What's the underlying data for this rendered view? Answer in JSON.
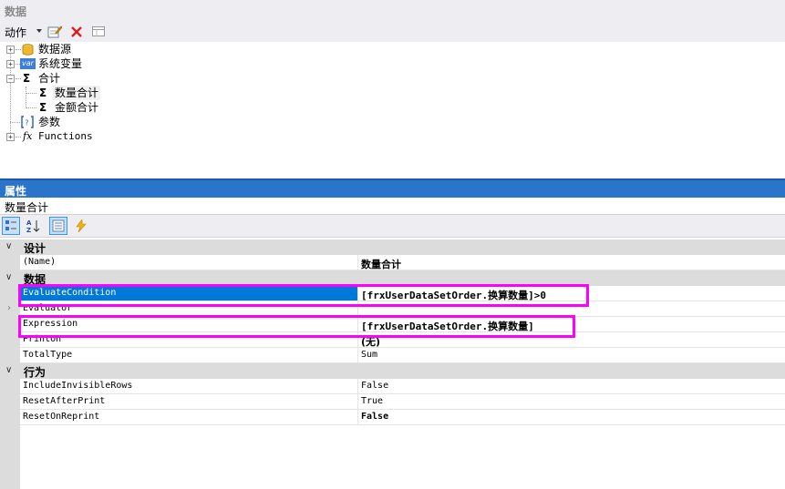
{
  "data_panel": {
    "title": "数据",
    "toolbar": {
      "actions_label": "动作"
    },
    "tree": {
      "datasource": "数据源",
      "system_vars": "系统变量",
      "system_vars_icon_text": "var",
      "totals": "合计",
      "total_qty": "数量合计",
      "total_amount": "金额合计",
      "params": "参数",
      "functions": "Functions",
      "fx_symbol": "fx",
      "sigma": "Σ",
      "expand_plus": "+",
      "expand_minus": "−"
    }
  },
  "prop_panel": {
    "title": "属性",
    "object_name": "数量合计",
    "categories": {
      "design": "设计",
      "data": "数据",
      "behavior": "行为"
    },
    "rows": {
      "name": {
        "label": "(Name)",
        "value": "数量合计"
      },
      "evaluate_condition": {
        "label": "EvaluateCondition",
        "value": "[frxUserDataSetOrder.换算数量]>0"
      },
      "evaluator": {
        "label": "Evaluator",
        "value": ""
      },
      "expression": {
        "label": "Expression",
        "value": "[frxUserDataSetOrder.换算数量]"
      },
      "print_on": {
        "label": "PrintOn",
        "value": "(无)"
      },
      "total_type": {
        "label": "TotalType",
        "value": "Sum"
      },
      "include_invisible_rows": {
        "label": "IncludeInvisibleRows",
        "value": "False"
      },
      "reset_after_print": {
        "label": "ResetAfterPrint",
        "value": "True"
      },
      "reset_on_reprint": {
        "label": "ResetOnReprint",
        "value": "False"
      }
    }
  },
  "colors": {
    "title_bar": "#2a74c9",
    "selection": "#0078d7",
    "highlight_box": "#ff00ff",
    "category_bg": "#dcdcdc",
    "toolbar_bg": "#eeeef2"
  }
}
